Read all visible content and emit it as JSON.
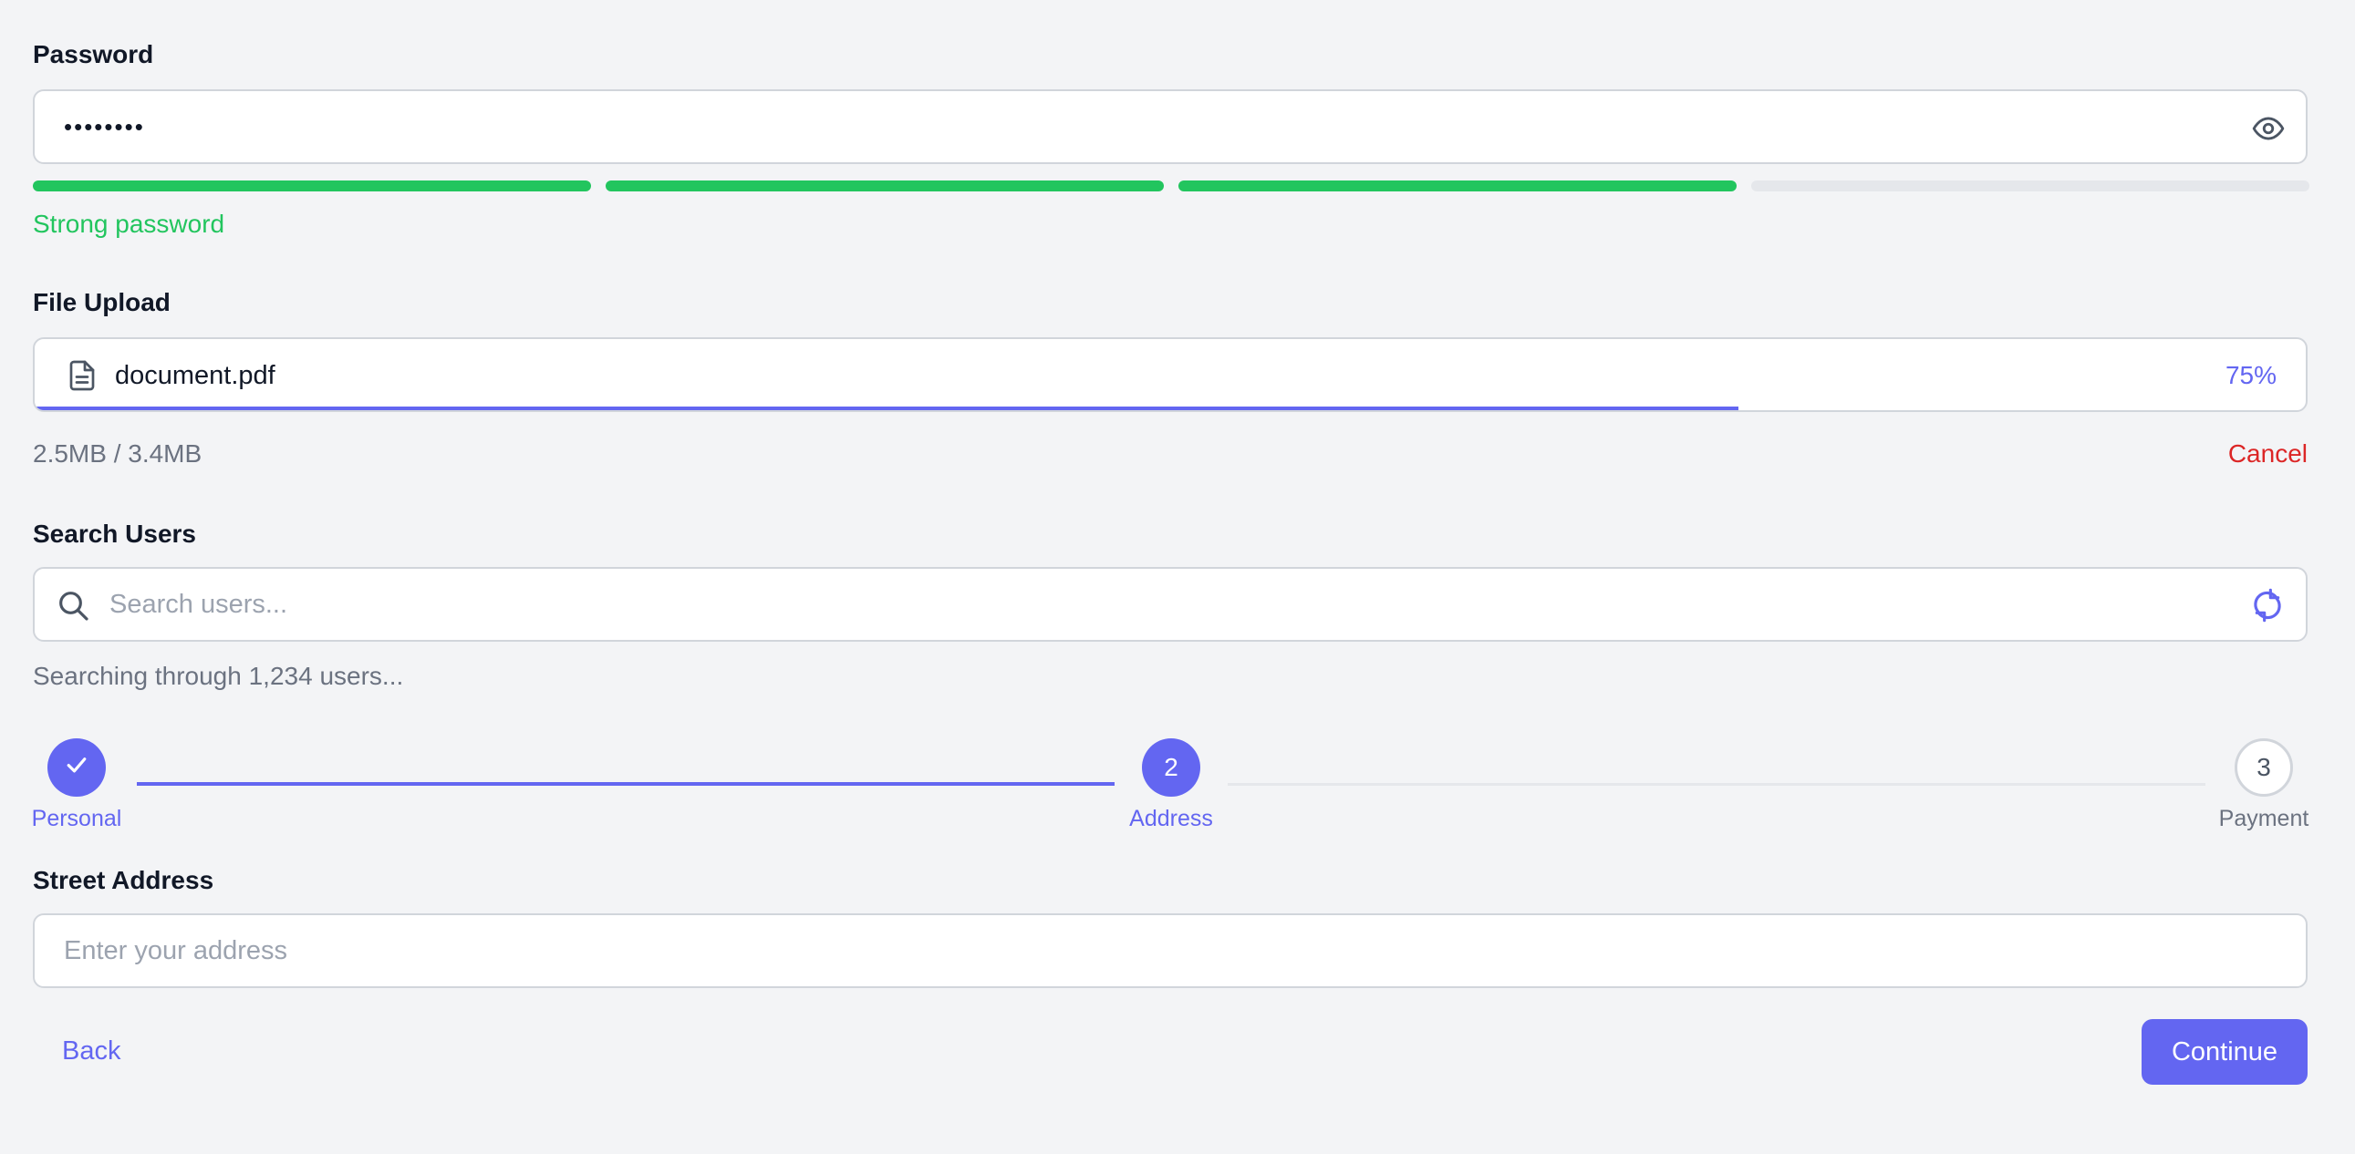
{
  "colors": {
    "accent": "#6366f1",
    "success": "#22c55e",
    "danger": "#dc2626",
    "muted": "#6b7280",
    "track": "#e5e7eb"
  },
  "password": {
    "label": "Password",
    "value": "••••••••",
    "toggle_icon": "eye-icon",
    "strength_segments_filled": 3,
    "strength_segments_total": 4,
    "strength_text": "Strong password"
  },
  "upload": {
    "label": "File Upload",
    "file_icon": "document-icon",
    "filename": "document.pdf",
    "percent_text": "75%",
    "progress": 0.75,
    "size_text": "2.5MB / 3.4MB",
    "cancel_label": "Cancel"
  },
  "search": {
    "label": "Search Users",
    "search_icon": "search-icon",
    "placeholder": "Search users...",
    "value": "",
    "loading_icon": "refresh-icon",
    "status_text": "Searching through 1,234 users..."
  },
  "stepper": {
    "steps": [
      {
        "number": "",
        "label": "Personal",
        "state": "complete",
        "icon": "check-icon"
      },
      {
        "number": "2",
        "label": "Address",
        "state": "current"
      },
      {
        "number": "3",
        "label": "Payment",
        "state": "upcoming"
      }
    ]
  },
  "address": {
    "label": "Street Address",
    "placeholder": "Enter your address",
    "value": ""
  },
  "actions": {
    "back_label": "Back",
    "continue_label": "Continue"
  }
}
